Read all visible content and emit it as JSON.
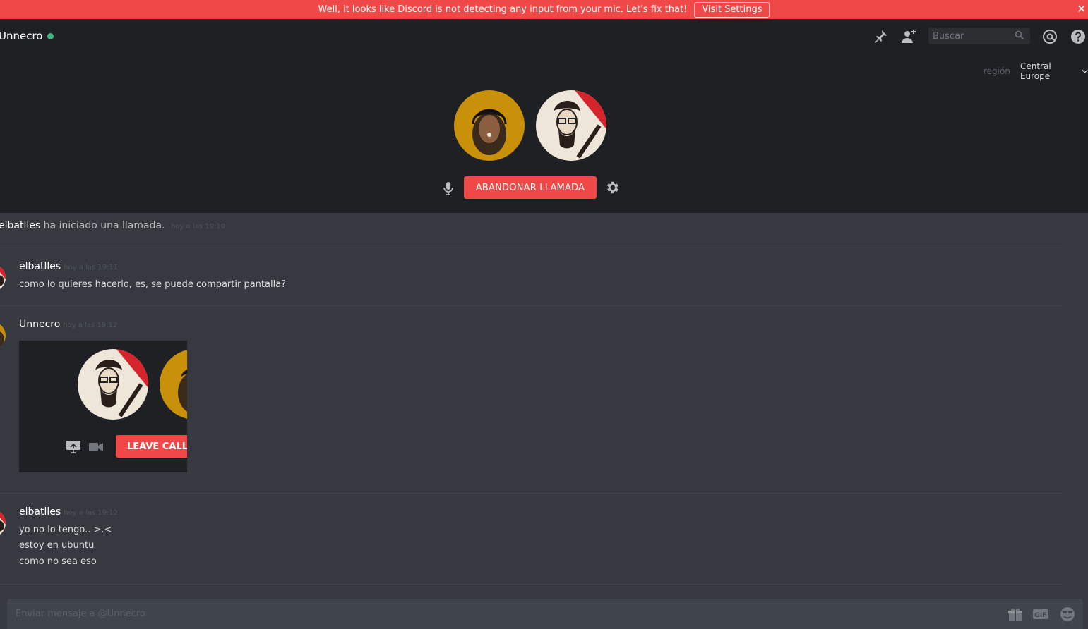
{
  "notice": {
    "text": "Well, it looks like Discord is not detecting any input from your mic. Let's fix that!",
    "button_label": "Visit Settings",
    "close_glyph": "✕"
  },
  "header": {
    "channel_name": "Unnecro",
    "status_color": "#43b581",
    "search_placeholder": "Buscar",
    "icons": [
      "pin-icon",
      "add-friend-icon",
      "search-icon",
      "mention-icon",
      "help-icon"
    ]
  },
  "call": {
    "region_label": "región",
    "region_value": "Central Europe",
    "leave_button": "ABANDONAR LLAMADA",
    "accent_color": "#f04747"
  },
  "messages": {
    "system": {
      "name": "elbatlles",
      "text": "ha iniciado una llamada.",
      "timestamp": "hoy a las 19:10"
    },
    "groups": [
      {
        "author": "elbatlles",
        "timestamp": "hoy a las 19:11",
        "lines": [
          "como lo quieres hacerlo, es, se puede compartir pantalla?"
        ]
      },
      {
        "author": "Unnecro",
        "timestamp": "hoy a las 19:12",
        "embed": {
          "leave_button": "LEAVE CALL"
        }
      },
      {
        "author": "elbatlles",
        "timestamp": "hoy a las 19:12",
        "lines": [
          "yo no lo tengo.. >.<",
          "estoy en ubuntu",
          "como no sea eso"
        ]
      }
    ]
  },
  "composer": {
    "placeholder": "Enviar mensaje a @Unnecro",
    "icons": [
      "gift-icon",
      "gif-icon",
      "emoji-icon"
    ]
  }
}
